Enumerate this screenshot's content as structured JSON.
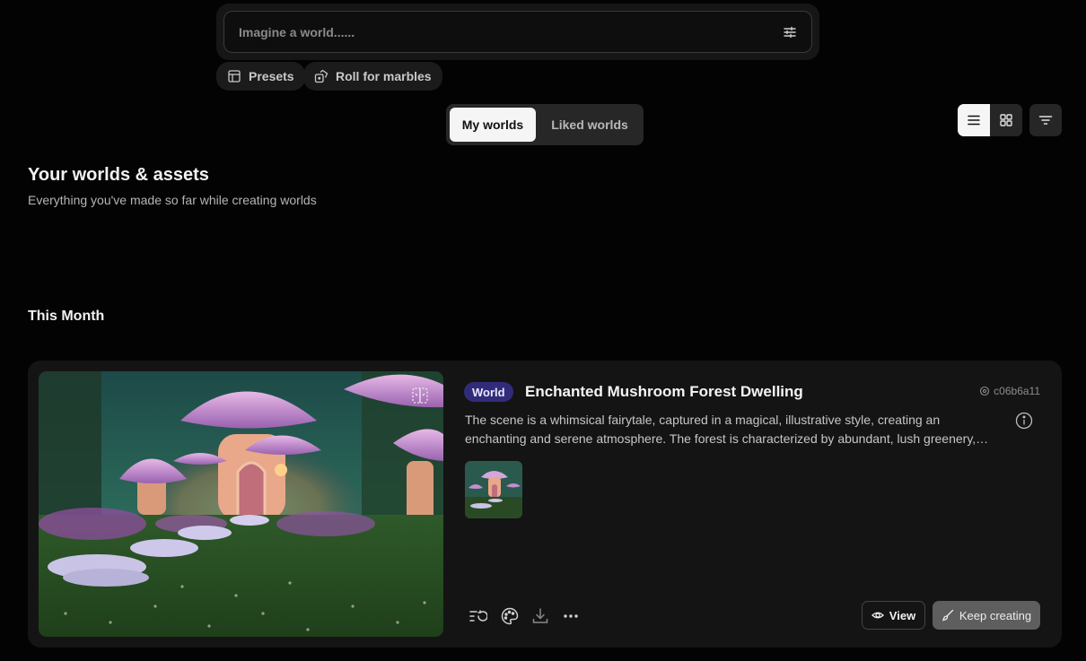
{
  "prompt": {
    "placeholder": "Imagine a world......"
  },
  "chips": {
    "presets": "Presets",
    "roll": "Roll for marbles"
  },
  "tabs": {
    "my_worlds": "My worlds",
    "liked_worlds": "Liked worlds"
  },
  "header": {
    "title": "Your worlds & assets",
    "subtitle": "Everything you've made so far while creating worlds"
  },
  "section": {
    "title": "This Month"
  },
  "card": {
    "badge": "World",
    "title": "Enchanted Mushroom Forest Dwelling",
    "id": "c06b6a11",
    "description": "The scene is a whimsical fairytale, captured in a magical, illustrative style, creating an enchanting and serene atmosphere. The forest is characterized by abundant, lush greenery, towering mushroom dwellings glowing with warm light.",
    "view_label": "View",
    "keep_label": "Keep creating"
  },
  "icons": [
    "sliders-icon",
    "layout-icon",
    "dice-icon",
    "list-icon",
    "grid-icon",
    "filter-icon",
    "expand-icon",
    "id-icon",
    "info-icon",
    "history-icon",
    "palette-icon",
    "download-icon",
    "more-icon",
    "eye-icon",
    "brush-icon"
  ],
  "colors": {
    "background": "#030303",
    "card": "#141414",
    "badge": "#312c7a",
    "accent_light": "#f5f5f5"
  }
}
